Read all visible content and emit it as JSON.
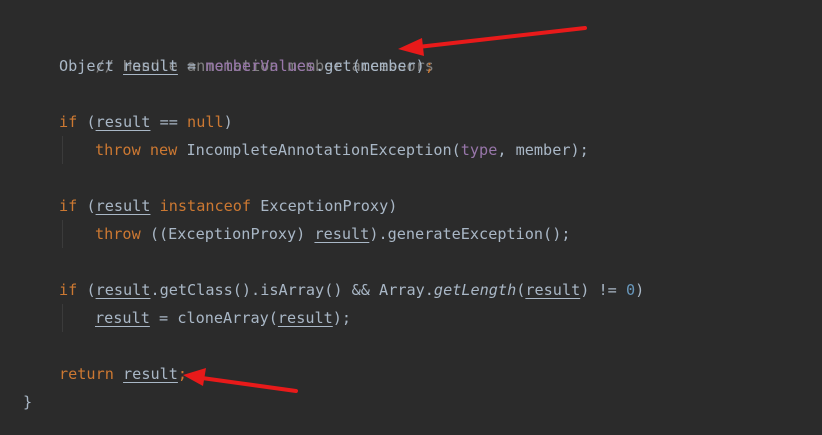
{
  "code": {
    "comment": "// Handle annotation member accessors",
    "type_object": "Object",
    "var_result": "result",
    "op_assign": " = ",
    "member_values": "memberValues",
    "get_call": ".get(member)",
    "semicolon": ";",
    "kw_if": "if",
    "paren_open": " (",
    "op_eq_null_prefix": " == ",
    "kw_null": "null",
    "paren_close": ")",
    "kw_throw": "throw",
    "kw_new": "new",
    "incomplete_exception": " IncompleteAnnotationException(",
    "type_field": "type",
    "member_arg": ", member);",
    "kw_instanceof": "instanceof",
    "exception_proxy_close": " ExceptionProxy)",
    "cast_open": " ((ExceptionProxy) ",
    "generate_exception": ").generateException();",
    "get_class_chain": ".getClass().isArray() && Array.",
    "get_length": "getLength",
    "length_open": "(",
    "neq": ") != ",
    "zero": "0",
    "close_paren": ")",
    "clone_array_open": "cloneArray(",
    "clone_array_close": ");",
    "kw_return": "return",
    "closing_brace": "}"
  },
  "annotation_color": "#e81a1a"
}
